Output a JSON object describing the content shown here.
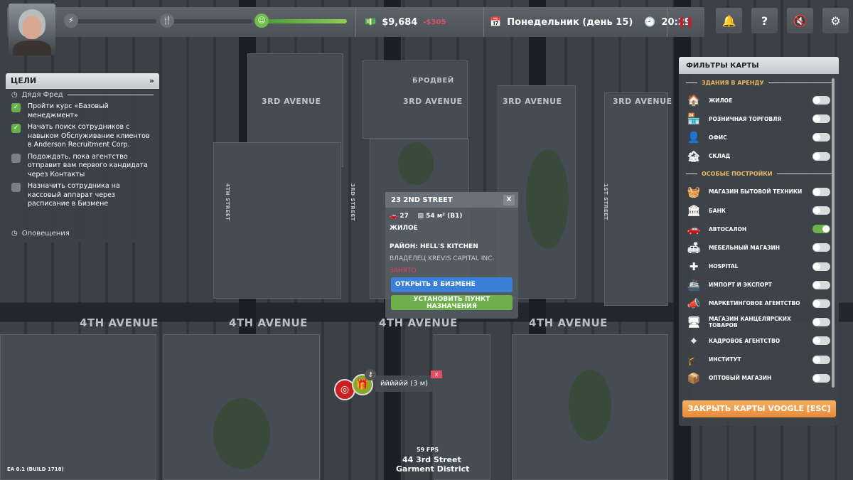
{
  "topbar": {
    "money": "$9,684",
    "money_delta": "-$305",
    "date": "Понедельник (день 15)",
    "time": "20:29",
    "mood_level": 1.0,
    "energy_level": 0.02,
    "hunger_level": 0.0
  },
  "icons": {
    "pause": "pause-icon",
    "notifications": "bell-icon",
    "help": "?",
    "mute": "mute-icon",
    "settings": "gear-icon"
  },
  "goals": {
    "title": "ЦЕЛИ",
    "section": "Дядя Фред",
    "items": [
      {
        "text": "Пройти курс «Базовый менеджмент»",
        "done": true
      },
      {
        "text": "Начать поиск сотрудников с навыком Обслуживание клиентов в Anderson Recruitment Corp.",
        "done": true
      },
      {
        "text": "Подождать, пока агентство отправит вам первого кандидата через Контакты",
        "done": false
      },
      {
        "text": "Назначить сотрудника на кассовый аппарат через расписание в Бизмене",
        "done": false
      }
    ],
    "notifications": "Оповещения"
  },
  "popup": {
    "title": "23 2ND STREET",
    "close": "X",
    "parking": "27",
    "area": "54 м² (B1)",
    "type": "ЖИЛОЕ",
    "district": "РАЙОН: HELL'S KITCHEN",
    "owner": "ВЛАДЕЛЕЦ KREVIS CAPITAL INC.",
    "status": "ЗАНЯТО",
    "open_btn": "ОТКРЫТЬ В БИЗМЕНЕ",
    "dest_btn": "УСТАНОВИТЬ ПУНКТ НАЗНАЧЕНИЯ"
  },
  "filters": {
    "title": "ФИЛЬТРЫ КАРТЫ",
    "rent_section": "ЗДАНИЯ В АРЕНДУ",
    "special_section": "ОСОБЫЕ ПОСТРОЙКИ",
    "rent": [
      {
        "label": "ЖИЛОЕ",
        "icon": "🏠",
        "on": false
      },
      {
        "label": "РОЗНИЧНАЯ ТОРГОВЛЯ",
        "icon": "🏪",
        "on": false
      },
      {
        "label": "ОФИС",
        "icon": "👤",
        "on": false
      },
      {
        "label": "СКЛАД",
        "icon": "🏚",
        "on": false
      }
    ],
    "special": [
      {
        "label": "МАГАЗИН БЫТОВОЙ ТЕХНИКИ",
        "icon": "🧺",
        "on": false
      },
      {
        "label": "БАНК",
        "icon": "🏛",
        "on": false
      },
      {
        "label": "АВТОСАЛОН",
        "icon": "🚗",
        "on": true
      },
      {
        "label": "МЕБЕЛЬНЫЙ МАГАЗИН",
        "icon": "🛋",
        "on": false
      },
      {
        "label": "HOSPITAL",
        "icon": "✚",
        "on": false
      },
      {
        "label": "ИМПОРТ И ЭКСПОРТ",
        "icon": "🚢",
        "on": false
      },
      {
        "label": "МАРКЕТИНГОВОЕ АГЕНТСТВО",
        "icon": "📣",
        "on": false
      },
      {
        "label": "МАГАЗИН КАНЦЕЛЯРСКИХ ТОВАРОВ",
        "icon": "🖥",
        "on": false
      },
      {
        "label": "КАДРОВОЕ АГЕНТСТВО",
        "icon": "⌖",
        "on": false
      },
      {
        "label": "ИНСТИТУТ",
        "icon": "🎓",
        "on": false
      },
      {
        "label": "ОПТОВЫЙ МАГАЗИН",
        "icon": "📦",
        "on": false
      }
    ],
    "close": "ЗАКРЫТЬ КАРТЫ VOOGLE [ESC]"
  },
  "marker": {
    "label": "йййййй (3 м)",
    "close": "x"
  },
  "location": {
    "fps": "59 FPS",
    "street": "44 3rd Street",
    "district": "Garment District"
  },
  "version": "EA 0.1 (BUILD 1718)",
  "streets": {
    "a3": "3RD AVENUE",
    "a4": "4TH AVENUE",
    "broadway": "БРОДВЕЙ",
    "s3": "3RD STREET",
    "s1": "1ST STREET",
    "s4": "4TH STREET"
  }
}
